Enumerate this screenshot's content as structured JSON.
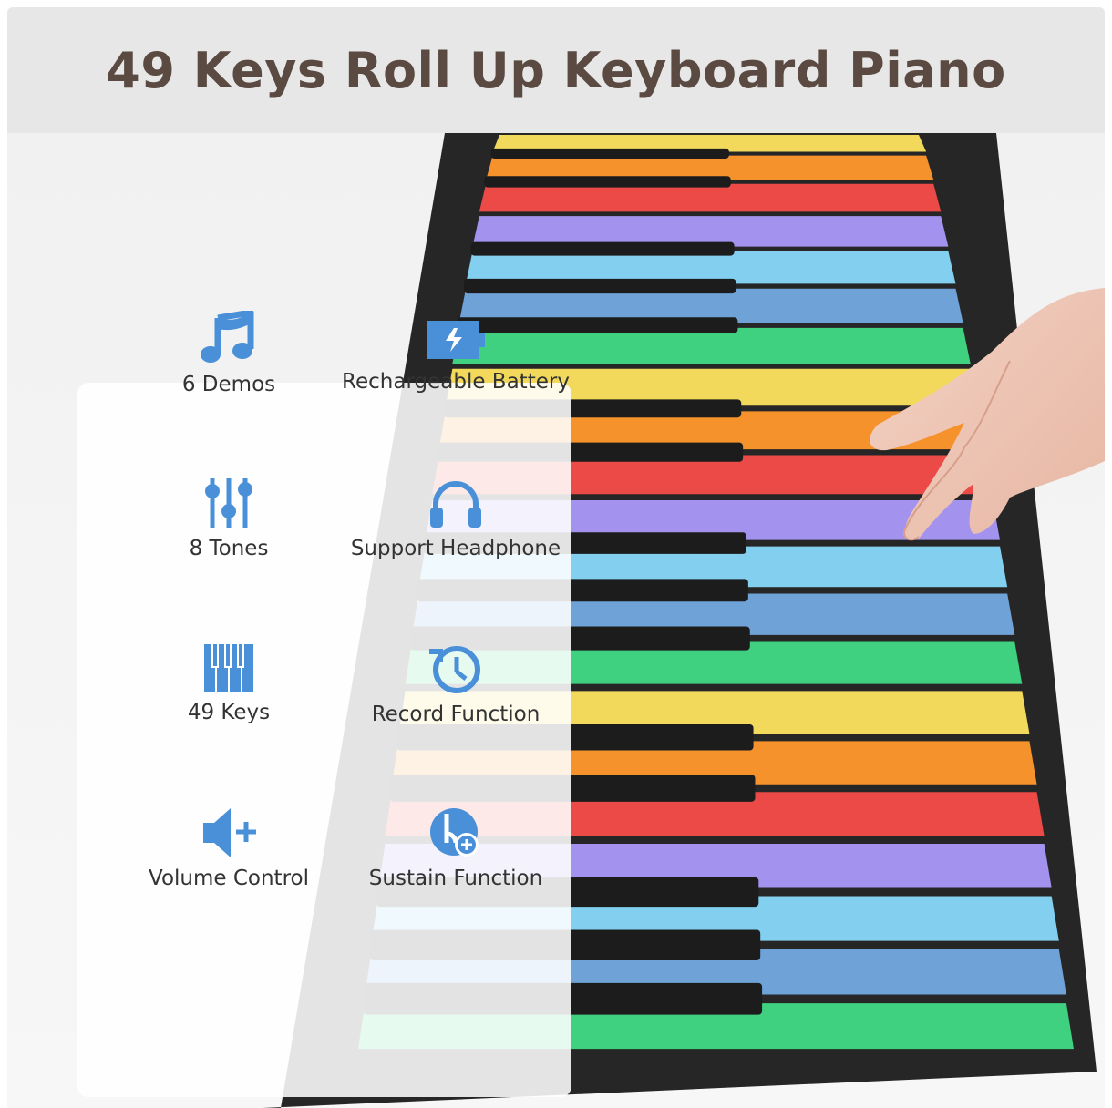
{
  "header": {
    "title": "49 Keys Roll Up Keyboard Piano"
  },
  "features": [
    {
      "label": "6 Demos",
      "icon": "music-notes-icon"
    },
    {
      "label": "Rechargeable Battery",
      "icon": "battery-charging-icon"
    },
    {
      "label": "8 Tones",
      "icon": "equalizer-sliders-icon"
    },
    {
      "label": "Support Headphone",
      "icon": "headphones-icon"
    },
    {
      "label": "49 Keys",
      "icon": "piano-keys-icon"
    },
    {
      "label": "Record Function",
      "icon": "record-clock-icon"
    },
    {
      "label": "Volume Control",
      "icon": "volume-up-icon"
    },
    {
      "label": "Sustain Function",
      "icon": "sustain-plus-icon"
    }
  ],
  "colors": {
    "title": "#5a4a42",
    "icon": "#4a90d9",
    "keys": [
      "#f2d95c",
      "#f5922b",
      "#ec4a46",
      "#a393ee",
      "#82cff0",
      "#6fa3d8",
      "#3fd17f"
    ],
    "mat": "#2a2a2a"
  }
}
